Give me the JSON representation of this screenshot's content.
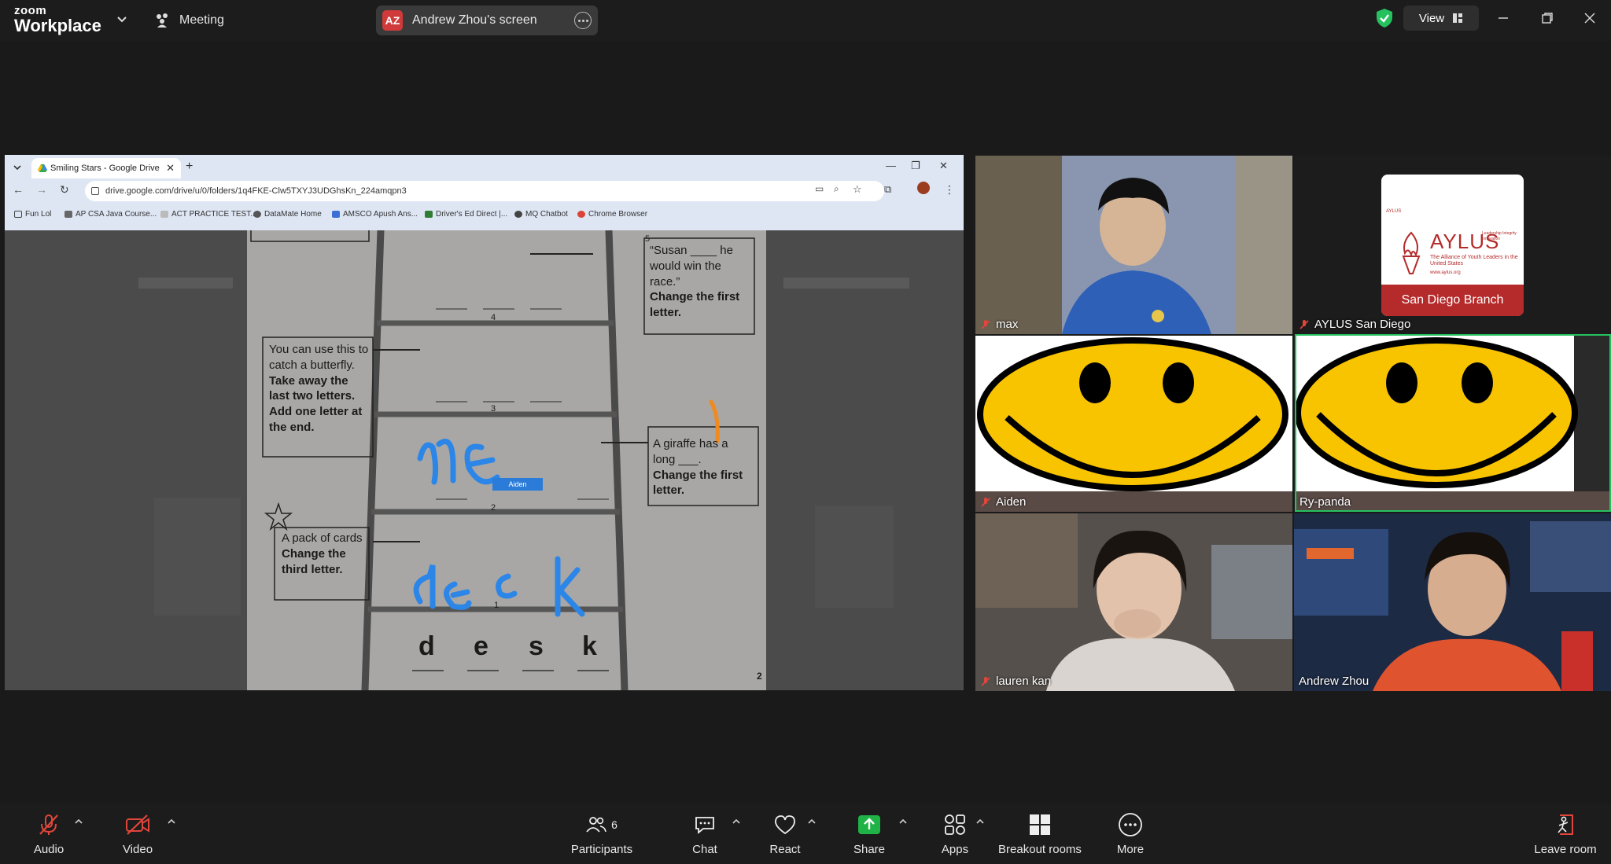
{
  "titlebar": {
    "logo_line1": "zoom",
    "logo_line2": "Workplace",
    "meeting_label": "Meeting",
    "share_initials": "AZ",
    "share_label": "Andrew Zhou's screen",
    "view_label": "View"
  },
  "browser": {
    "tab_title": "Smiling Stars - Google Drive",
    "url": "drive.google.com/drive/u/0/folders/1q4FKE-Clw5TXYJ3UDGhsKn_224amqpn3",
    "bookmarks": [
      "Fun Lol",
      "AP CSA Java Course...",
      "ACT PRACTICE TEST...",
      "DataMate Home",
      "AMSCO Apush Ans...",
      "Driver's Ed Direct |...",
      "MQ Chatbot",
      "Chrome Browser"
    ]
  },
  "worksheet": {
    "clue_susan": "“Susan ____ he would win the race.”",
    "clue_susan_bold": "Change the first letter.",
    "clue_butterfly": "You can use this to catch a butterfly.",
    "clue_butterfly_bold": "Take away the last two letters. Add one letter at the end.",
    "clue_giraffe": "A giraffe has a long ___.",
    "clue_giraffe_bold": "Change the first letter.",
    "clue_cards": "A pack of cards",
    "clue_cards_bold": "Change the third letter.",
    "rung_numbers": [
      "5",
      "4",
      "3",
      "2",
      "1"
    ],
    "start_letters": [
      "d",
      "e",
      "s",
      "k"
    ],
    "handwriting_1": "ne",
    "handwriting_2": "deck",
    "annotator_tag": "Aiden",
    "page_number": "2"
  },
  "participants_video": [
    {
      "name": "max",
      "muted": true
    },
    {
      "name": "AYLUS San Diego",
      "muted": true
    },
    {
      "name": "Aiden",
      "muted": true
    },
    {
      "name": "Ry-panda",
      "muted": false
    },
    {
      "name": "lauren kan",
      "muted": true
    },
    {
      "name": "Andrew Zhou",
      "muted": false
    }
  ],
  "aylus_card": {
    "org_small": "AYLUS",
    "org_big": "AYLUS",
    "tagline": "The Alliance of Youth Leaders in the United States",
    "side_words": "Leadership Integrity Innovation",
    "site": "www.aylus.org",
    "branch": "San Diego Branch"
  },
  "toolbar": {
    "audio": "Audio",
    "video": "Video",
    "participants": "Participants",
    "participants_count": "6",
    "chat": "Chat",
    "react": "React",
    "share": "Share",
    "apps": "Apps",
    "breakout": "Breakout rooms",
    "more": "More",
    "leave": "Leave room"
  },
  "colors": {
    "accent_green": "#25c15f",
    "share_green": "#1fb347",
    "mute_red": "#e0463b",
    "smiley_yellow": "#f8c400",
    "aylus_red": "#b52a2a",
    "pen_blue": "#2b86e8",
    "pen_orange": "#f08a1e"
  }
}
